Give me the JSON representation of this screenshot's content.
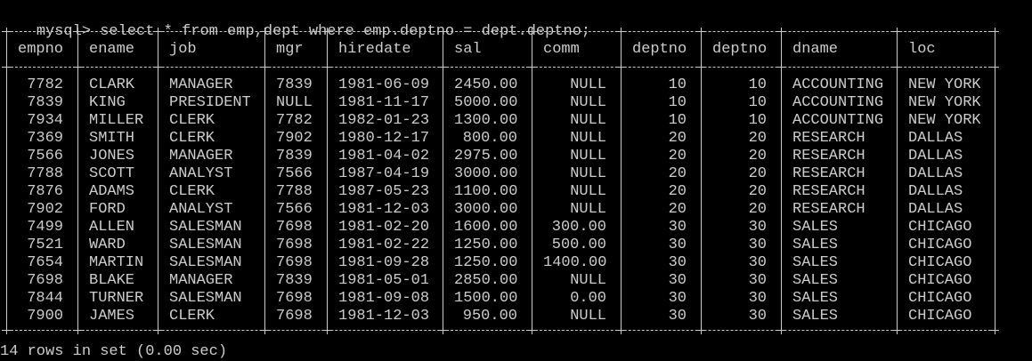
{
  "terminal": {
    "prompt": "mysql>",
    "command": "select * from emp,dept where emp.deptno = dept.deptno;",
    "footer": "14 rows in set (0.00 sec)",
    "colors": {
      "background": "#000000",
      "foreground": "#cccccc"
    }
  },
  "table": {
    "columns": [
      "empno",
      "ename",
      "job",
      "mgr",
      "hiredate",
      "sal",
      "comm",
      "deptno",
      "deptno",
      "dname",
      "loc"
    ],
    "rows": [
      [
        "7782",
        "CLARK",
        "MANAGER",
        "7839",
        "1981-06-09",
        "2450.00",
        "NULL",
        "10",
        "10",
        "ACCOUNTING",
        "NEW YORK"
      ],
      [
        "7839",
        "KING",
        "PRESIDENT",
        "NULL",
        "1981-11-17",
        "5000.00",
        "NULL",
        "10",
        "10",
        "ACCOUNTING",
        "NEW YORK"
      ],
      [
        "7934",
        "MILLER",
        "CLERK",
        "7782",
        "1982-01-23",
        "1300.00",
        "NULL",
        "10",
        "10",
        "ACCOUNTING",
        "NEW YORK"
      ],
      [
        "7369",
        "SMITH",
        "CLERK",
        "7902",
        "1980-12-17",
        "800.00",
        "NULL",
        "20",
        "20",
        "RESEARCH",
        "DALLAS"
      ],
      [
        "7566",
        "JONES",
        "MANAGER",
        "7839",
        "1981-04-02",
        "2975.00",
        "NULL",
        "20",
        "20",
        "RESEARCH",
        "DALLAS"
      ],
      [
        "7788",
        "SCOTT",
        "ANALYST",
        "7566",
        "1987-04-19",
        "3000.00",
        "NULL",
        "20",
        "20",
        "RESEARCH",
        "DALLAS"
      ],
      [
        "7876",
        "ADAMS",
        "CLERK",
        "7788",
        "1987-05-23",
        "1100.00",
        "NULL",
        "20",
        "20",
        "RESEARCH",
        "DALLAS"
      ],
      [
        "7902",
        "FORD",
        "ANALYST",
        "7566",
        "1981-12-03",
        "3000.00",
        "NULL",
        "20",
        "20",
        "RESEARCH",
        "DALLAS"
      ],
      [
        "7499",
        "ALLEN",
        "SALESMAN",
        "7698",
        "1981-02-20",
        "1600.00",
        "300.00",
        "30",
        "30",
        "SALES",
        "CHICAGO"
      ],
      [
        "7521",
        "WARD",
        "SALESMAN",
        "7698",
        "1981-02-22",
        "1250.00",
        "500.00",
        "30",
        "30",
        "SALES",
        "CHICAGO"
      ],
      [
        "7654",
        "MARTIN",
        "SALESMAN",
        "7698",
        "1981-09-28",
        "1250.00",
        "1400.00",
        "30",
        "30",
        "SALES",
        "CHICAGO"
      ],
      [
        "7698",
        "BLAKE",
        "MANAGER",
        "7839",
        "1981-05-01",
        "2850.00",
        "NULL",
        "30",
        "30",
        "SALES",
        "CHICAGO"
      ],
      [
        "7844",
        "TURNER",
        "SALESMAN",
        "7698",
        "1981-09-08",
        "1500.00",
        "0.00",
        "30",
        "30",
        "SALES",
        "CHICAGO"
      ],
      [
        "7900",
        "JAMES",
        "CLERK",
        "7698",
        "1981-12-03",
        "950.00",
        "NULL",
        "30",
        "30",
        "SALES",
        "CHICAGO"
      ]
    ]
  }
}
